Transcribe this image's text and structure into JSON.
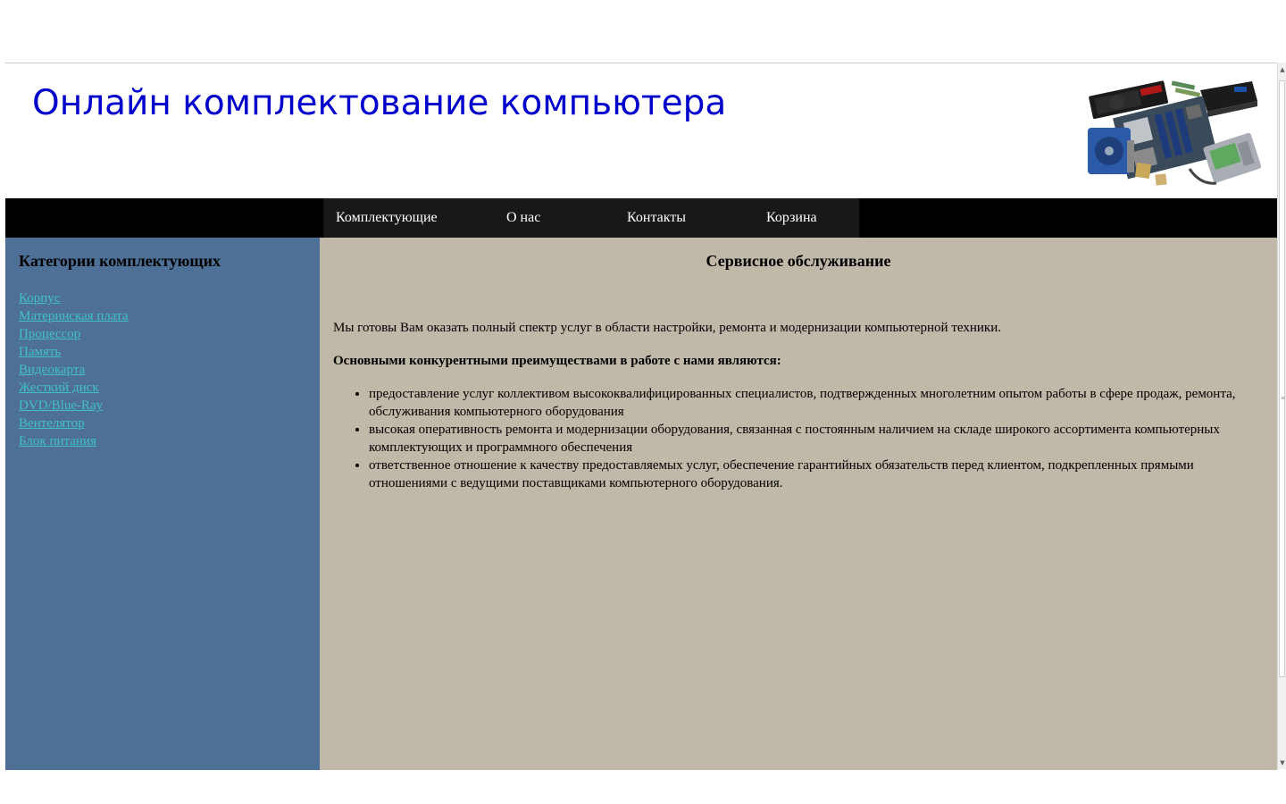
{
  "header": {
    "title": "Онлайн комплектование компьютера",
    "image_alt": "computer-components-image"
  },
  "nav": {
    "items": [
      {
        "label": "Комплектующие"
      },
      {
        "label": "О нас"
      },
      {
        "label": "Контакты"
      },
      {
        "label": "Корзина"
      }
    ]
  },
  "sidebar": {
    "title": "Категории комплектующих",
    "categories": [
      {
        "label": "Корпус"
      },
      {
        "label": "Материнская плата"
      },
      {
        "label": "Процессор"
      },
      {
        "label": "Память"
      },
      {
        "label": "Видеокарта"
      },
      {
        "label": "Жесткий диск"
      },
      {
        "label": "DVD/Blue-Ray"
      },
      {
        "label": "Вентелятор"
      },
      {
        "label": "Блок питания"
      }
    ]
  },
  "main": {
    "title": "Сервисное обслуживание",
    "intro": "Мы готовы Вам оказать полный спектр услуг в области настройки, ремонта и модернизации компьютерной техники.",
    "advantages_heading": "Основными конкурентными преимуществами в работе с нами являются:",
    "advantages": [
      "предоставление услуг коллективом высококвалифицированных специалистов, подтвержденных многолетним опытом работы в сфере продаж, ремонта, обслуживания компьютерного оборудования",
      "высокая оперативность ремонта и модернизации оборудования, связанная с постоянным наличием на складе широкого ассортимента компьютерных комплектующих и программного обеспечения",
      "ответственное отношение к качеству предоставляемых услуг, обеспечение гарантийных обязательств перед клиентом, подкрепленных прямыми отношениями с ведущими поставщиками компьютерного оборудования."
    ]
  },
  "colors": {
    "title": "#0000cc",
    "navbar": "#000000",
    "nav_menu": "#181818",
    "sidebar": "#4e7096",
    "content": "#c0b8a8",
    "link": "#40c0c8"
  }
}
